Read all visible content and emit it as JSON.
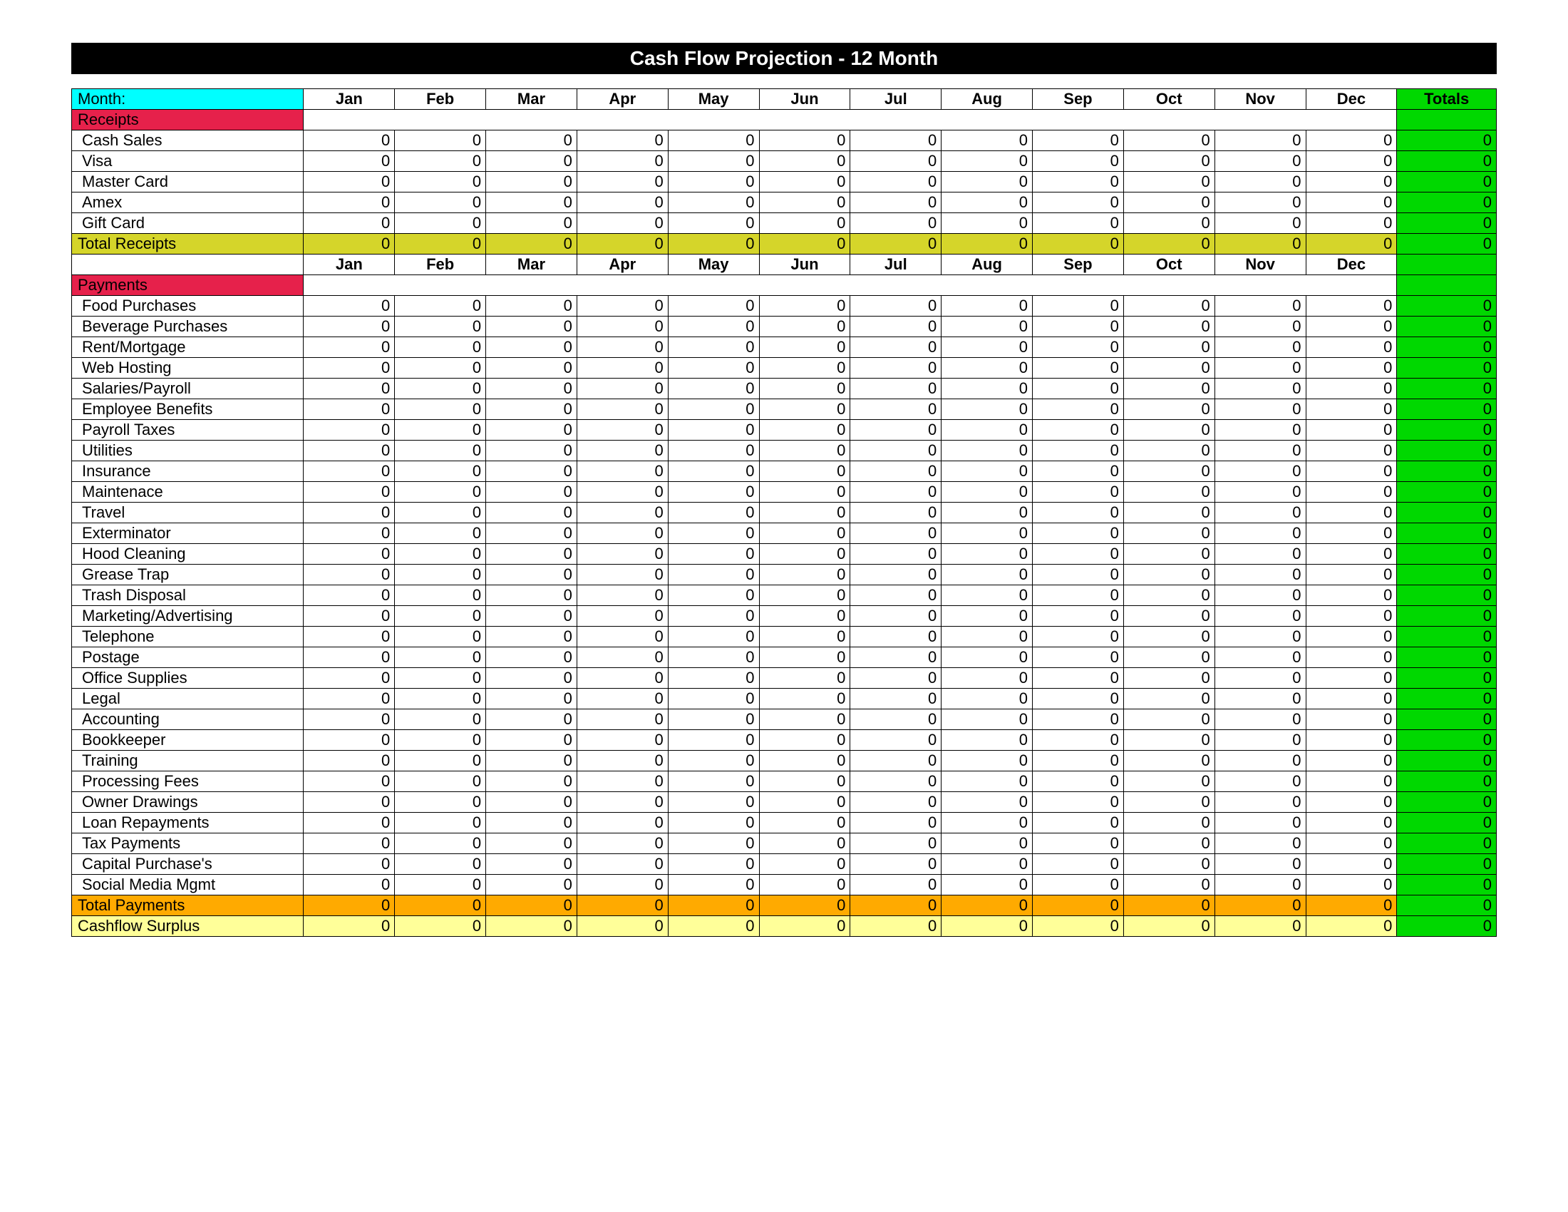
{
  "title": "Cash Flow Projection    -     12 Month",
  "monthLabel": "Month:",
  "months": [
    "Jan",
    "Feb",
    "Mar",
    "Apr",
    "May",
    "Jun",
    "Jul",
    "Aug",
    "Sep",
    "Oct",
    "Nov",
    "Dec"
  ],
  "totalsHeader": "Totals",
  "receiptsHeader": "Receipts",
  "receipts": [
    {
      "label": "Cash Sales",
      "vals": [
        0,
        0,
        0,
        0,
        0,
        0,
        0,
        0,
        0,
        0,
        0,
        0
      ],
      "total": 0
    },
    {
      "label": "Visa",
      "vals": [
        0,
        0,
        0,
        0,
        0,
        0,
        0,
        0,
        0,
        0,
        0,
        0
      ],
      "total": 0
    },
    {
      "label": "Master Card",
      "vals": [
        0,
        0,
        0,
        0,
        0,
        0,
        0,
        0,
        0,
        0,
        0,
        0
      ],
      "total": 0
    },
    {
      "label": "Amex",
      "vals": [
        0,
        0,
        0,
        0,
        0,
        0,
        0,
        0,
        0,
        0,
        0,
        0
      ],
      "total": 0
    },
    {
      "label": "Gift Card",
      "vals": [
        0,
        0,
        0,
        0,
        0,
        0,
        0,
        0,
        0,
        0,
        0,
        0
      ],
      "total": 0
    }
  ],
  "totalReceipts": {
    "label": "Total Receipts",
    "vals": [
      0,
      0,
      0,
      0,
      0,
      0,
      0,
      0,
      0,
      0,
      0,
      0
    ],
    "total": 0
  },
  "paymentsHeader": "Payments",
  "payments": [
    {
      "label": "Food Purchases",
      "vals": [
        0,
        0,
        0,
        0,
        0,
        0,
        0,
        0,
        0,
        0,
        0,
        0
      ],
      "total": 0
    },
    {
      "label": "Beverage Purchases",
      "vals": [
        0,
        0,
        0,
        0,
        0,
        0,
        0,
        0,
        0,
        0,
        0,
        0
      ],
      "total": 0
    },
    {
      "label": "Rent/Mortgage",
      "vals": [
        0,
        0,
        0,
        0,
        0,
        0,
        0,
        0,
        0,
        0,
        0,
        0
      ],
      "total": 0
    },
    {
      "label": "Web Hosting",
      "vals": [
        0,
        0,
        0,
        0,
        0,
        0,
        0,
        0,
        0,
        0,
        0,
        0
      ],
      "total": 0
    },
    {
      "label": "Salaries/Payroll",
      "vals": [
        0,
        0,
        0,
        0,
        0,
        0,
        0,
        0,
        0,
        0,
        0,
        0
      ],
      "total": 0
    },
    {
      "label": "Employee Benefits",
      "vals": [
        0,
        0,
        0,
        0,
        0,
        0,
        0,
        0,
        0,
        0,
        0,
        0
      ],
      "total": 0
    },
    {
      "label": "Payroll Taxes",
      "vals": [
        0,
        0,
        0,
        0,
        0,
        0,
        0,
        0,
        0,
        0,
        0,
        0
      ],
      "total": 0
    },
    {
      "label": "Utilities",
      "vals": [
        0,
        0,
        0,
        0,
        0,
        0,
        0,
        0,
        0,
        0,
        0,
        0
      ],
      "total": 0
    },
    {
      "label": "Insurance",
      "vals": [
        0,
        0,
        0,
        0,
        0,
        0,
        0,
        0,
        0,
        0,
        0,
        0
      ],
      "total": 0
    },
    {
      "label": "Maintenace",
      "vals": [
        0,
        0,
        0,
        0,
        0,
        0,
        0,
        0,
        0,
        0,
        0,
        0
      ],
      "total": 0
    },
    {
      "label": "Travel",
      "vals": [
        0,
        0,
        0,
        0,
        0,
        0,
        0,
        0,
        0,
        0,
        0,
        0
      ],
      "total": 0
    },
    {
      "label": "Exterminator",
      "vals": [
        0,
        0,
        0,
        0,
        0,
        0,
        0,
        0,
        0,
        0,
        0,
        0
      ],
      "total": 0
    },
    {
      "label": "Hood Cleaning",
      "vals": [
        0,
        0,
        0,
        0,
        0,
        0,
        0,
        0,
        0,
        0,
        0,
        0
      ],
      "total": 0
    },
    {
      "label": "Grease Trap",
      "vals": [
        0,
        0,
        0,
        0,
        0,
        0,
        0,
        0,
        0,
        0,
        0,
        0
      ],
      "total": 0
    },
    {
      "label": "Trash Disposal",
      "vals": [
        0,
        0,
        0,
        0,
        0,
        0,
        0,
        0,
        0,
        0,
        0,
        0
      ],
      "total": 0
    },
    {
      "label": "Marketing/Advertising",
      "vals": [
        0,
        0,
        0,
        0,
        0,
        0,
        0,
        0,
        0,
        0,
        0,
        0
      ],
      "total": 0
    },
    {
      "label": "Telephone",
      "vals": [
        0,
        0,
        0,
        0,
        0,
        0,
        0,
        0,
        0,
        0,
        0,
        0
      ],
      "total": 0
    },
    {
      "label": "Postage",
      "vals": [
        0,
        0,
        0,
        0,
        0,
        0,
        0,
        0,
        0,
        0,
        0,
        0
      ],
      "total": 0
    },
    {
      "label": "Office Supplies",
      "vals": [
        0,
        0,
        0,
        0,
        0,
        0,
        0,
        0,
        0,
        0,
        0,
        0
      ],
      "total": 0
    },
    {
      "label": "Legal",
      "vals": [
        0,
        0,
        0,
        0,
        0,
        0,
        0,
        0,
        0,
        0,
        0,
        0
      ],
      "total": 0
    },
    {
      "label": "Accounting",
      "vals": [
        0,
        0,
        0,
        0,
        0,
        0,
        0,
        0,
        0,
        0,
        0,
        0
      ],
      "total": 0
    },
    {
      "label": "Bookkeeper",
      "vals": [
        0,
        0,
        0,
        0,
        0,
        0,
        0,
        0,
        0,
        0,
        0,
        0
      ],
      "total": 0
    },
    {
      "label": "Training",
      "vals": [
        0,
        0,
        0,
        0,
        0,
        0,
        0,
        0,
        0,
        0,
        0,
        0
      ],
      "total": 0
    },
    {
      "label": "Processing Fees",
      "vals": [
        0,
        0,
        0,
        0,
        0,
        0,
        0,
        0,
        0,
        0,
        0,
        0
      ],
      "total": 0
    },
    {
      "label": "Owner Drawings",
      "vals": [
        0,
        0,
        0,
        0,
        0,
        0,
        0,
        0,
        0,
        0,
        0,
        0
      ],
      "total": 0
    },
    {
      "label": "Loan Repayments",
      "vals": [
        0,
        0,
        0,
        0,
        0,
        0,
        0,
        0,
        0,
        0,
        0,
        0
      ],
      "total": 0
    },
    {
      "label": "Tax Payments",
      "vals": [
        0,
        0,
        0,
        0,
        0,
        0,
        0,
        0,
        0,
        0,
        0,
        0
      ],
      "total": 0
    },
    {
      "label": "Capital Purchase's",
      "vals": [
        0,
        0,
        0,
        0,
        0,
        0,
        0,
        0,
        0,
        0,
        0,
        0
      ],
      "total": 0
    },
    {
      "label": "Social Media Mgmt",
      "vals": [
        0,
        0,
        0,
        0,
        0,
        0,
        0,
        0,
        0,
        0,
        0,
        0
      ],
      "total": 0
    }
  ],
  "totalPayments": {
    "label": "Total Payments",
    "vals": [
      0,
      0,
      0,
      0,
      0,
      0,
      0,
      0,
      0,
      0,
      0,
      0
    ],
    "total": 0
  },
  "surplus": {
    "label": "Cashflow Surplus",
    "vals": [
      0,
      0,
      0,
      0,
      0,
      0,
      0,
      0,
      0,
      0,
      0,
      0
    ],
    "total": 0
  }
}
